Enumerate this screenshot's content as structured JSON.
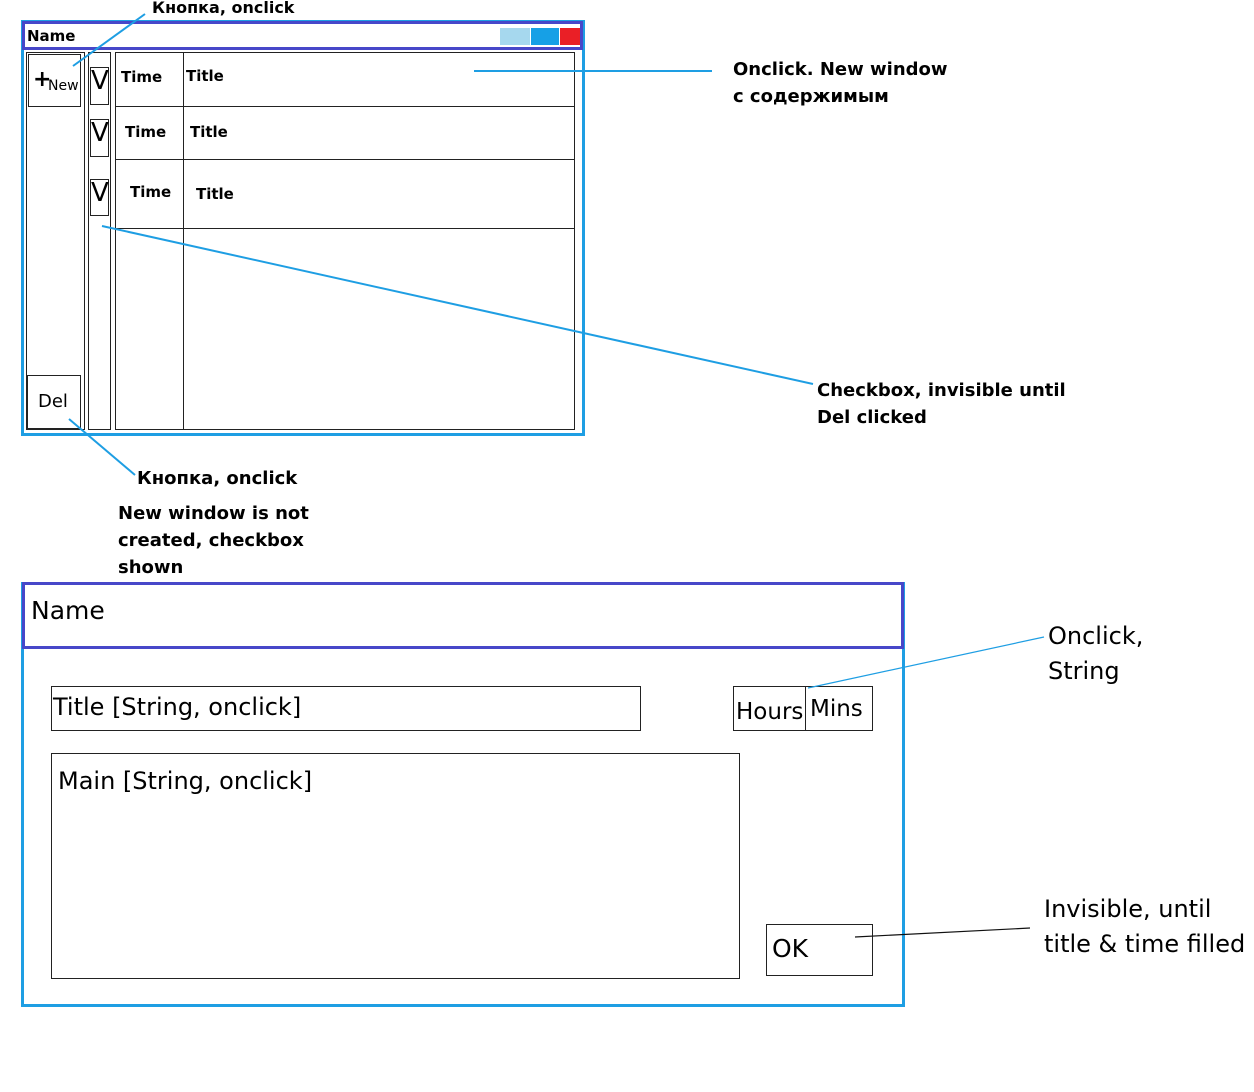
{
  "main_window": {
    "title": "Name",
    "new_button": {
      "icon": "+",
      "label": "New"
    },
    "delete_button": {
      "label": "Del"
    },
    "checkbox_mark": "V",
    "rows": [
      {
        "time": "Time",
        "title": "Title"
      },
      {
        "time": "Time",
        "title": "Title"
      },
      {
        "time": "Time",
        "title": "Title"
      }
    ]
  },
  "edit_window": {
    "title": "Name",
    "title_field": "Title [String, onclick]",
    "hours_label": "Hours",
    "mins_label": "Mins",
    "main_field": "Main [String, onclick]",
    "ok_button": "OK"
  },
  "annotations": {
    "new_button_note": "Кнопка, onclick",
    "row_note": [
      "Onclick. New window",
      "с содержимым"
    ],
    "checkbox_note": [
      "Checkbox, invisible until",
      "Del clicked"
    ],
    "del_button_note": "Кнопка, onclick",
    "del_behavior_note": [
      "New window is not",
      "created, checkbox",
      "shown"
    ],
    "time_note": [
      "Onclick,",
      "String"
    ],
    "ok_note": [
      "Invisible, until",
      "title & time filled"
    ]
  },
  "colors": {
    "window_border": "#1e9ee3",
    "title_border": "#4747c9",
    "minimize": "#a6d8ee",
    "maximize": "#16a0e6",
    "close": "#ea1f26",
    "annotation_line": "#1e9ee3"
  }
}
